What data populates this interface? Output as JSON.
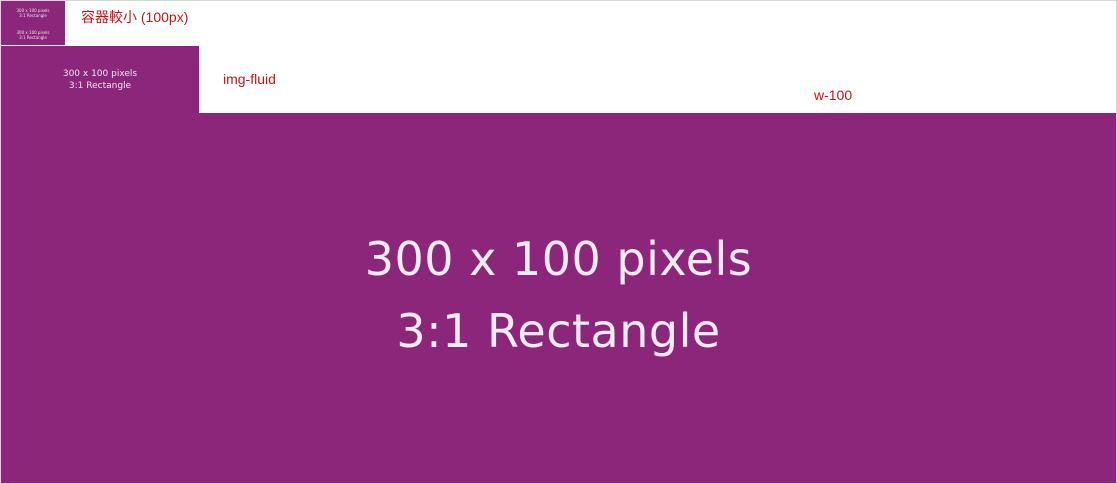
{
  "image": {
    "line1": "300 x 100 pixels",
    "line2": "3:1 Rectangle",
    "background_color": "#8b267b",
    "text_color": "#ece6ee"
  },
  "captions": {
    "small_container": "容器較小 (100px)",
    "img_fluid": "img-fluid",
    "w_100": "w-100",
    "color": "#d01010"
  }
}
